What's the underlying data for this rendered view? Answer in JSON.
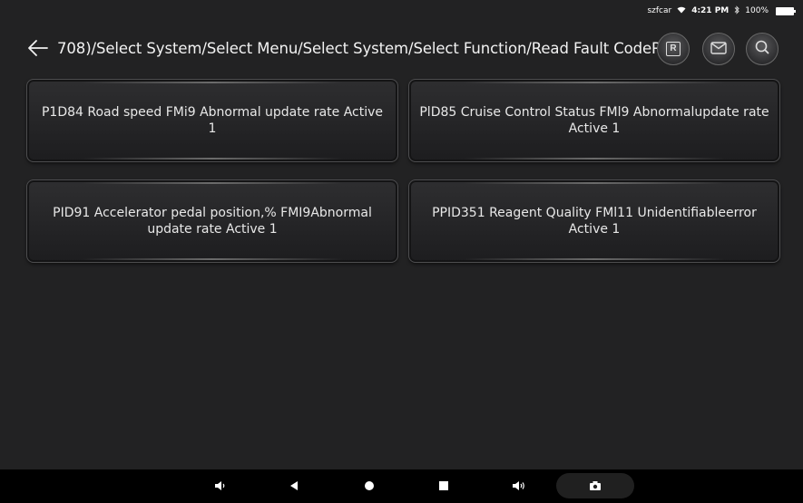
{
  "status_bar": {
    "carrier": "szfcar",
    "wifi_icon": "wifi-icon",
    "time": "4:21 PM",
    "bluetooth_icon": "bluetooth-icon",
    "battery": "100%"
  },
  "header": {
    "back_icon": "back-arrow-icon",
    "title": "708)/Select System/Select Menu/Select System/Select Function/Read Fault CodeR",
    "tools": [
      {
        "name": "report",
        "icon": "report-icon",
        "label": "R"
      },
      {
        "name": "mail",
        "icon": "mail-icon"
      },
      {
        "name": "search",
        "icon": "search-icon"
      }
    ]
  },
  "fault_codes": [
    {
      "text": "P1D84 Road speed FMi9 Abnormal update rate Active 1"
    },
    {
      "text": "PlD85 Cruise Control Status FMl9 Abnormalupdate rate  Active 1"
    },
    {
      "text": "PID91 Accelerator pedal position,% FMI9Abnormal update rate Active 1"
    },
    {
      "text": "PPID351 Reagent Quality FMl11 Unidentifiableerror Active 1"
    }
  ],
  "nav_bar": {
    "buttons": [
      "volume-down-icon",
      "back-triangle-icon",
      "home-circle-icon",
      "recents-square-icon",
      "volume-up-icon",
      "camera-icon"
    ]
  },
  "colors": {
    "background": "#222223",
    "card_bg": "#262628",
    "card_border": "#4d4d4f",
    "text": "#e8e8e8",
    "nav_bar": "#000000"
  }
}
